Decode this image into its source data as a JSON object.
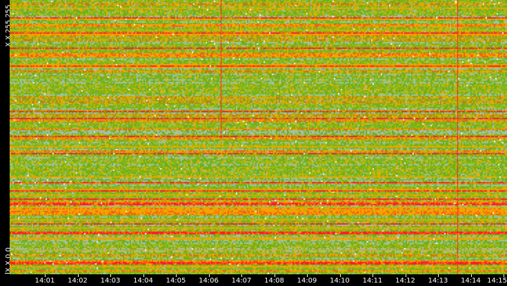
{
  "chart_data": {
    "type": "heatmap",
    "y_labels": {
      "bottom": "X.X.0.0",
      "top": "X.X.255.255"
    },
    "x_tick_labels": [
      "14:01",
      "14:02",
      "14:03",
      "14:04",
      "14:05",
      "14:06",
      "14:07",
      "14:08",
      "14:09",
      "14:10",
      "14:11",
      "14:12",
      "14:13",
      "14:14",
      "14:15"
    ],
    "x_range_minutes": [
      0.0,
      15.1
    ],
    "rows": 200,
    "columns": 360,
    "color_scale": [
      "#9dc3a8",
      "#6fae1c",
      "#93bb18",
      "#e3b000",
      "#ff9a00",
      "#ff5a10",
      "#ff1a2a"
    ],
    "vertical_markers": [
      {
        "time": "14:06.3",
        "extent": "top half",
        "color": "#ff2020"
      },
      {
        "time": "14:13.4",
        "extent": "full",
        "color": "#ff2020"
      }
    ]
  }
}
